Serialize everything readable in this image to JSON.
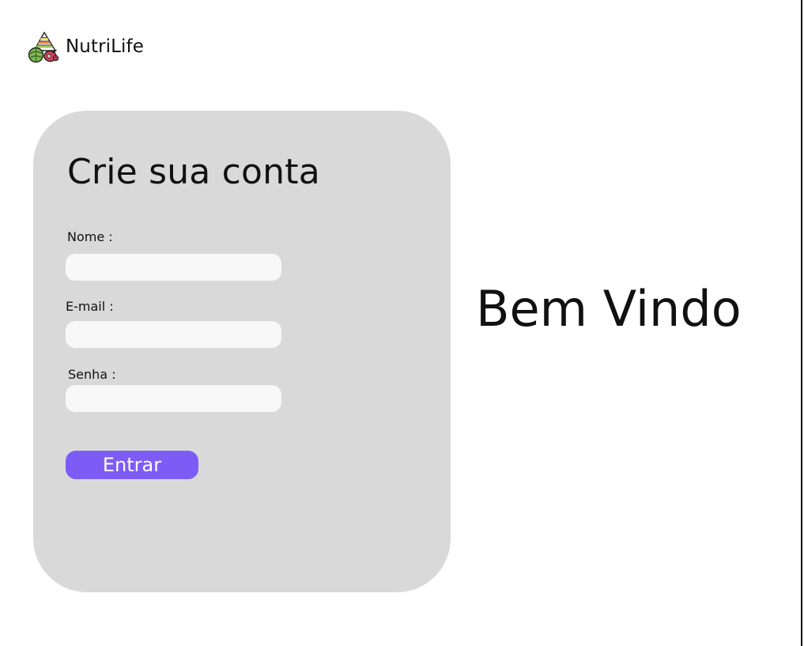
{
  "brand": {
    "name": "NutriLife",
    "icon": "food-pyramid-logo-icon"
  },
  "signup_card": {
    "title": "Crie sua conta",
    "fields": [
      {
        "label": "Nome :",
        "value": "",
        "placeholder": ""
      },
      {
        "label": "E-mail :",
        "value": "",
        "placeholder": ""
      },
      {
        "label": "Senha :",
        "value": "",
        "placeholder": ""
      }
    ],
    "submit_label": "Entrar"
  },
  "welcome": {
    "text": "Bem Vindo"
  },
  "colors": {
    "card_background": "#d9d9d9",
    "input_background": "#f8f8f8",
    "button_background": "#7d5cf6",
    "button_text": "#ffffff",
    "text": "#111111"
  }
}
